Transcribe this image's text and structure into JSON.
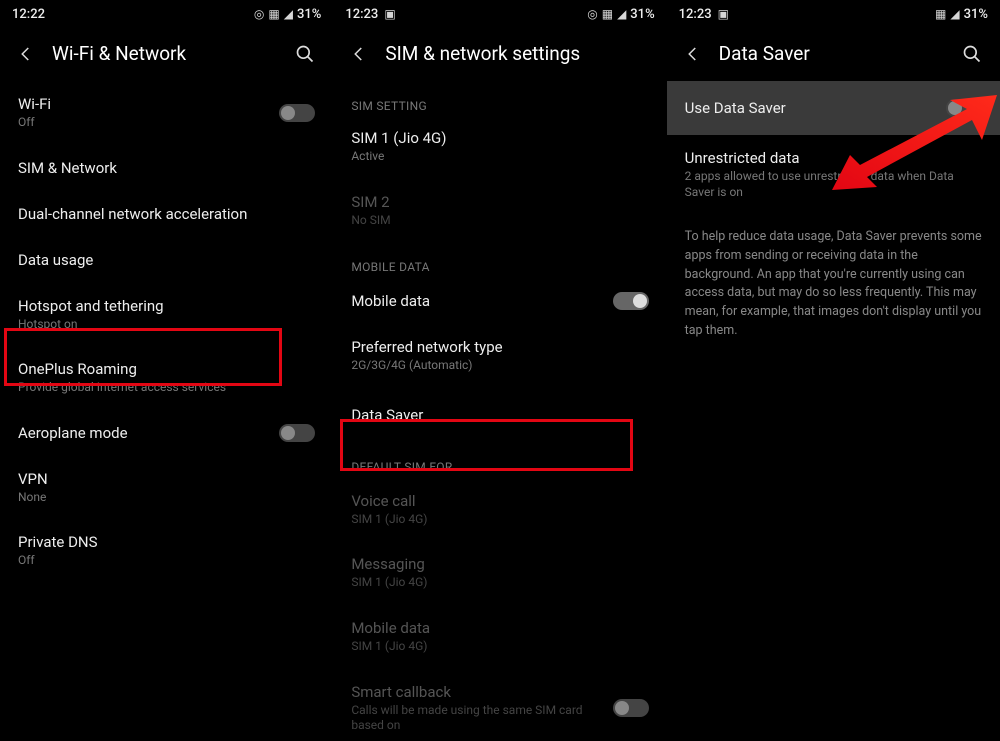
{
  "screen1": {
    "status": {
      "time": "12:22",
      "battery": "31%"
    },
    "title": "Wi-Fi & Network",
    "rows": [
      {
        "title": "Wi-Fi",
        "sub": "Off"
      },
      {
        "title": "SIM & Network"
      },
      {
        "title": "Dual-channel network acceleration"
      },
      {
        "title": "Data usage"
      },
      {
        "title": "Hotspot and tethering",
        "sub": "Hotspot on"
      },
      {
        "title": "OnePlus Roaming",
        "sub": "Provide global Internet access services"
      },
      {
        "title": "Aeroplane mode"
      },
      {
        "title": "VPN",
        "sub": "None"
      },
      {
        "title": "Private DNS",
        "sub": "Off"
      }
    ]
  },
  "screen2": {
    "status": {
      "time": "12:23",
      "battery": "31%"
    },
    "title": "SIM & network settings",
    "sec_sim": "SIM SETTING",
    "sim1": {
      "title": "SIM 1 (Jio 4G)",
      "sub": "Active"
    },
    "sim2": {
      "title": "SIM 2",
      "sub": "No SIM"
    },
    "sec_mobile": "MOBILE DATA",
    "mobile_data": "Mobile data",
    "pref_net": {
      "title": "Preferred network type",
      "sub": "2G/3G/4G (Automatic)"
    },
    "data_saver": "Data Saver",
    "sec_default": "DEFAULT SIM FOR",
    "voice": {
      "title": "Voice call",
      "sub": "SIM 1 (Jio 4G)"
    },
    "msg": {
      "title": "Messaging",
      "sub": "SIM 1 (Jio 4G)"
    },
    "mdata": {
      "title": "Mobile data",
      "sub": "SIM 1 (Jio 4G)"
    },
    "smart": {
      "title": "Smart callback",
      "sub": "Calls will be made using the same SIM card based on"
    }
  },
  "screen3": {
    "status": {
      "time": "12:23",
      "battery": "31%"
    },
    "title": "Data Saver",
    "use": "Use Data Saver",
    "unres": {
      "title": "Unrestricted data",
      "sub": "2 apps allowed to use unrestricted data when Data Saver is on"
    },
    "desc": "To help reduce data usage, Data Saver prevents some apps from sending or receiving data in the background. An app that you're currently using can access data, but may do so less frequently. This may mean, for example, that images don't display until you tap them."
  }
}
